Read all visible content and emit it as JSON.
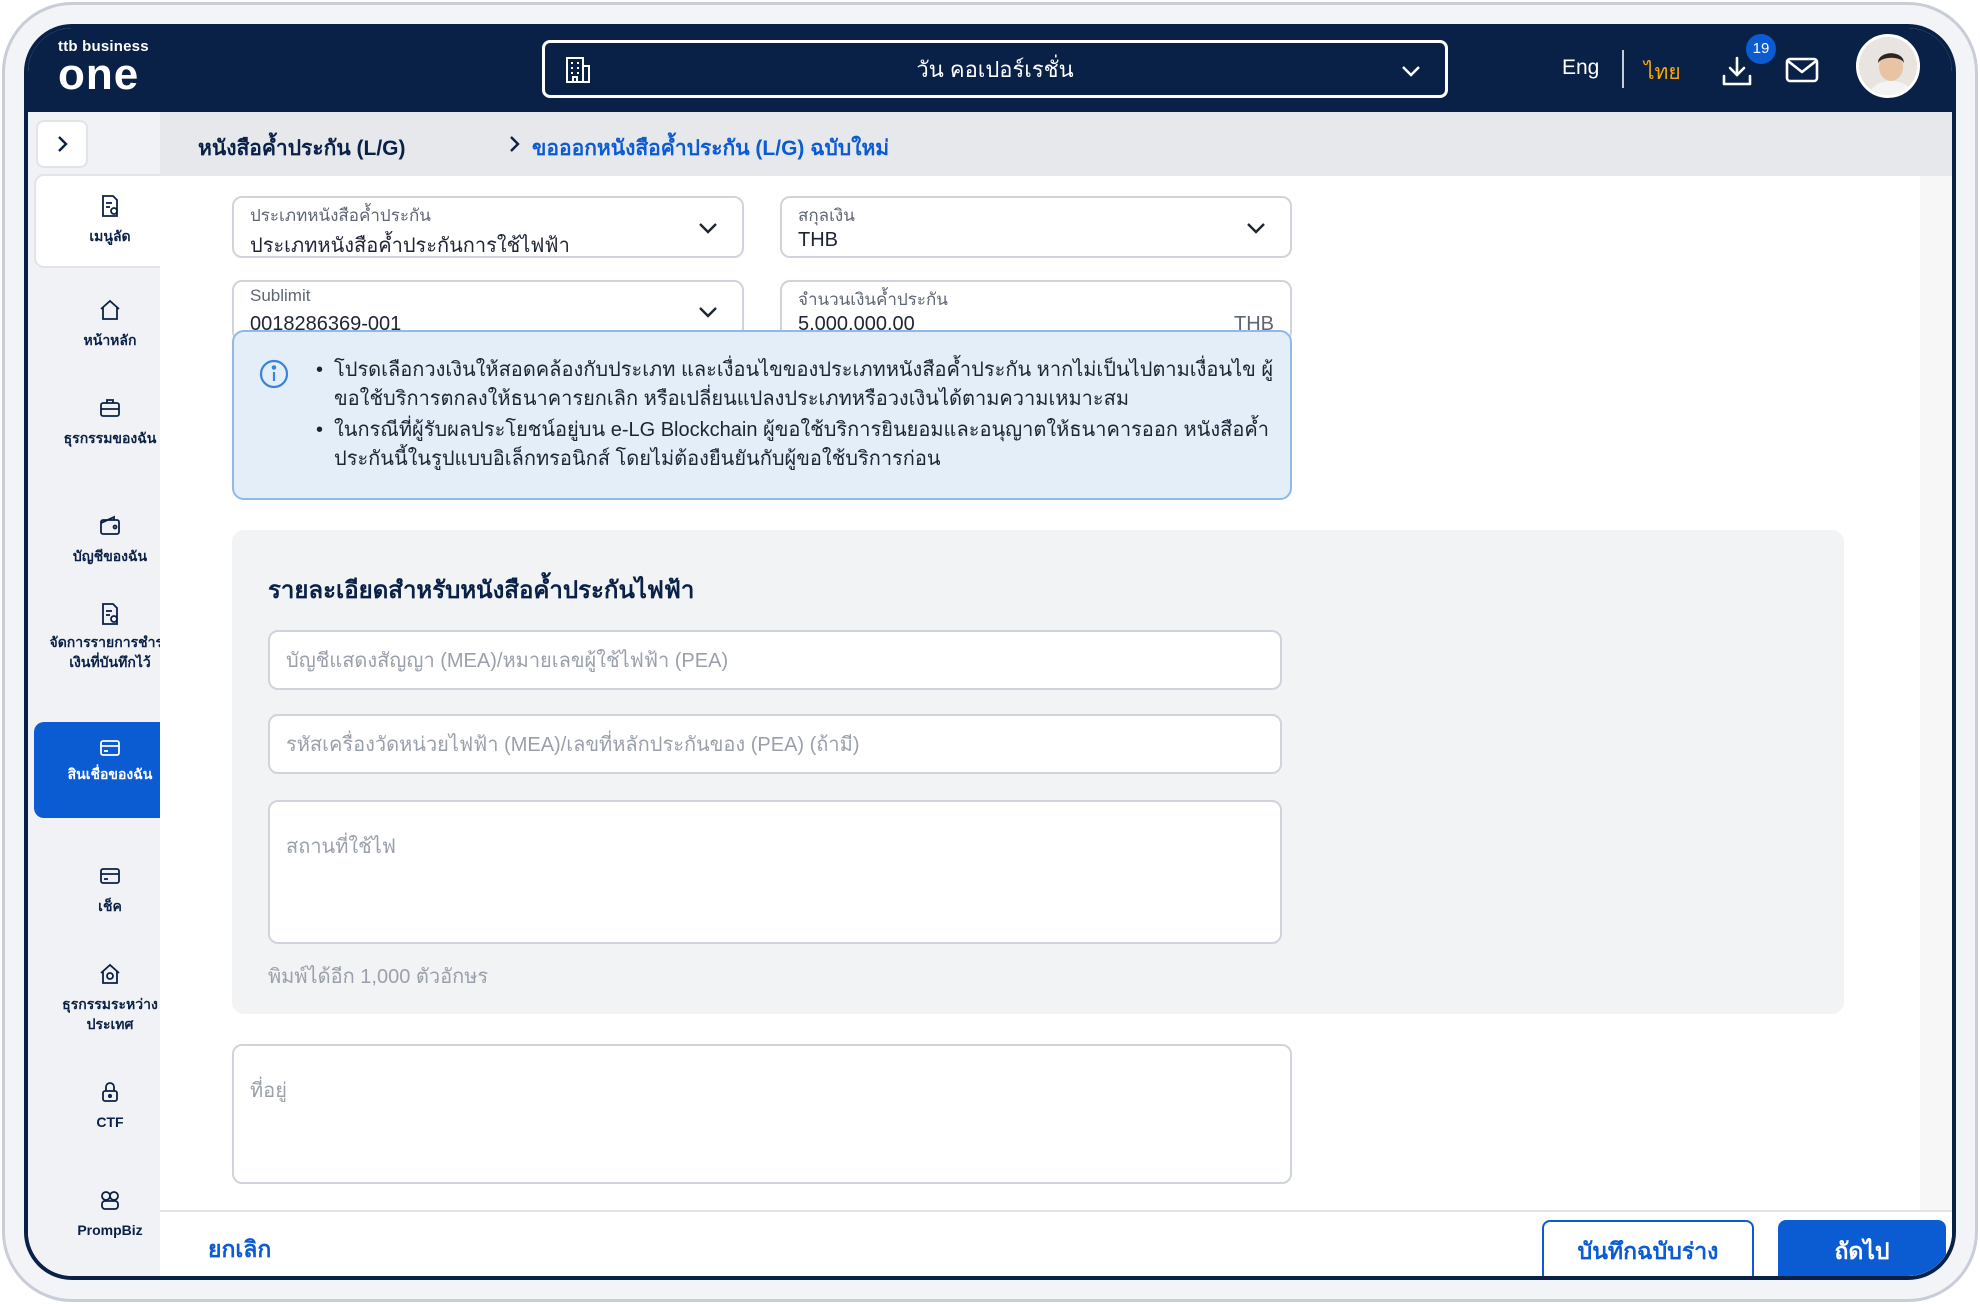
{
  "header": {
    "logo_top": "ttb business",
    "logo_main": "one",
    "company_name": "วัน คอเปอร์เรชั่น",
    "lang_en": "Eng",
    "lang_th": "ไทย",
    "active_lang": "th",
    "download_badge": "19",
    "colors": {
      "navy": "#0a2147",
      "accent": "#f7a600",
      "brand_blue": "#0b5bd3"
    }
  },
  "sidebar": {
    "items": [
      {
        "label": "เมนูลัด",
        "icon": "document-shortcut-icon",
        "has_arrow": true
      },
      {
        "label": "หน้าหลัก",
        "icon": "home-icon",
        "has_arrow": false
      },
      {
        "label": "ธุรกรรมของฉัน",
        "icon": "briefcase-icon",
        "has_arrow": true
      },
      {
        "label": "บัญชีของฉัน",
        "icon": "wallet-icon",
        "has_arrow": true
      },
      {
        "label": "จัดการรายการชำระเงินที่บันทึกไว้",
        "icon": "saved-payment-icon",
        "has_arrow": true
      },
      {
        "label": "สินเชื่อของฉัน",
        "icon": "loan-card-icon",
        "has_arrow": true,
        "active": true
      },
      {
        "label": "เช็ค",
        "icon": "cheque-icon",
        "has_arrow": true
      },
      {
        "label": "ธุรกรรมระหว่างประเทศ",
        "icon": "international-icon",
        "has_arrow": true
      },
      {
        "label": "CTF",
        "icon": "lock-icon",
        "has_arrow": false
      },
      {
        "label": "PrompBiz",
        "icon": "prompbiz-icon",
        "has_arrow": false
      }
    ]
  },
  "breadcrumb": {
    "parent": "หนังสือค้ำประกัน (L/G)",
    "current": "ขอออกหนังสือค้ำประกัน (L/G) ฉบับใหม่"
  },
  "form": {
    "lg_type": {
      "label": "ประเภทหนังสือค้ำประกัน",
      "value": "ประเภทหนังสือค้ำประกันการใช้ไฟฟ้า"
    },
    "currency": {
      "label": "สกุลเงิน",
      "value": "THB"
    },
    "sublimit": {
      "label": "Sublimit",
      "value": "0018286369-001"
    },
    "amount": {
      "label": "จำนวนเงินค้ำประกัน",
      "value": "5,000,000.00",
      "suffix": "THB"
    }
  },
  "info": {
    "bullets": [
      "โปรดเลือกวงเงินให้สอดคล้องกับประเภท และเงื่อนไขของประเภทหนังสือค้ำประกัน หากไม่เป็นไปตามเงื่อนไข ผู้ขอใช้บริการตกลงให้ธนาคารยกเลิก หรือเปลี่ยนแปลงประเภทหรือวงเงินได้ตามความเหมาะสม",
      "ในกรณีที่ผู้รับผลประโยชน์อยู่บน e-LG Blockchain ผู้ขอใช้บริการยินยอมและอนุญาตให้ธนาคารออก หนังสือค้ำประกันนี้ในรูปแบบอิเล็กทรอนิกส์ โดยไม่ต้องยืนยันกับผู้ขอใช้บริการก่อน"
    ]
  },
  "electric_section": {
    "title": "รายละเอียดสำหรับหนังสือค้ำประกันไฟฟ้า",
    "account_placeholder": "บัญชีแสดงสัญญา (MEA)/หมายเลขผู้ใช้ไฟฟ้า (PEA)",
    "meter_placeholder": "รหัสเครื่องวัดหน่วยไฟฟ้า (MEA)/เลขที่หลักประกันของ (PEA) (ถ้ามี)",
    "location_placeholder": "สถานที่ใช้ไฟ",
    "char_counter": "พิมพ์ได้อีก 1,000 ตัวอักษร"
  },
  "address": {
    "placeholder": "ที่อยู่"
  },
  "footer": {
    "cancel_label": "ยกเลิก",
    "draft_label": "บันทึกฉบับร่าง",
    "next_label": "ถัดไป"
  }
}
